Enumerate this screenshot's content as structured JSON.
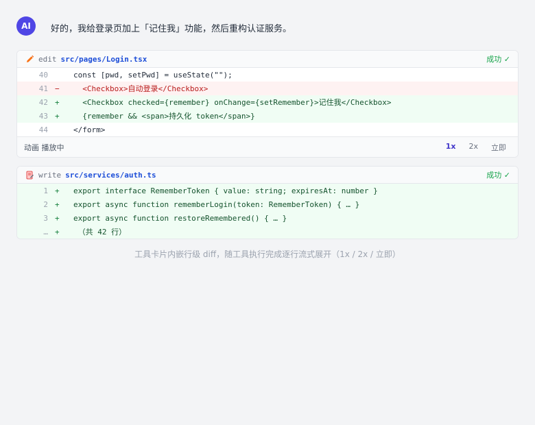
{
  "message": {
    "avatar": "AI",
    "text": "好的，我给登录页加上「记住我」功能，然后重构认证服务。"
  },
  "cards": [
    {
      "tool": "edit",
      "path": "src/pages/Login.tsx",
      "icon": "pencil-icon",
      "status": "成功 ✓",
      "lines": [
        {
          "num": "40",
          "mark": "",
          "code": "const [pwd, setPwd] = useState(\"\");",
          "type": "context"
        },
        {
          "num": "41",
          "mark": "−",
          "code": "  <Checkbox>自动登录</Checkbox>",
          "type": "del"
        },
        {
          "num": "42",
          "mark": "+",
          "code": "  <Checkbox checked={remember} onChange={setRemember}>记住我</Checkbox>",
          "type": "add"
        },
        {
          "num": "43",
          "mark": "+",
          "code": "  {remember && <span>持久化 token</span>}",
          "type": "add"
        },
        {
          "num": "44",
          "mark": "",
          "code": "</form>",
          "type": "context"
        }
      ],
      "footer": {
        "label": "动画 播放中",
        "speeds": [
          "1x",
          "2x",
          "立即"
        ],
        "active_speed": "1x"
      }
    },
    {
      "tool": "write",
      "path": "src/services/auth.ts",
      "icon": "file-write-icon",
      "status": "成功 ✓",
      "lines": [
        {
          "num": "1",
          "mark": "+",
          "code": "export interface RememberToken { value: string; expiresAt: number }",
          "type": "add"
        },
        {
          "num": "2",
          "mark": "+",
          "code": "export async function rememberLogin(token: RememberToken) { … }",
          "type": "add"
        },
        {
          "num": "3",
          "mark": "+",
          "code": "export async function restoreRemembered() { … }",
          "type": "add"
        },
        {
          "num": "…",
          "mark": "+",
          "code": " （共 42 行）",
          "type": "add"
        }
      ]
    }
  ],
  "caption": "工具卡片内嵌行级 diff，随工具执行完成逐行流式展开（1x / 2x / 立即）",
  "colors": {
    "accent": "#4f46e5",
    "success": "#16a34a",
    "del_bg": "#fef2f2",
    "add_bg": "#f0fdf4"
  }
}
